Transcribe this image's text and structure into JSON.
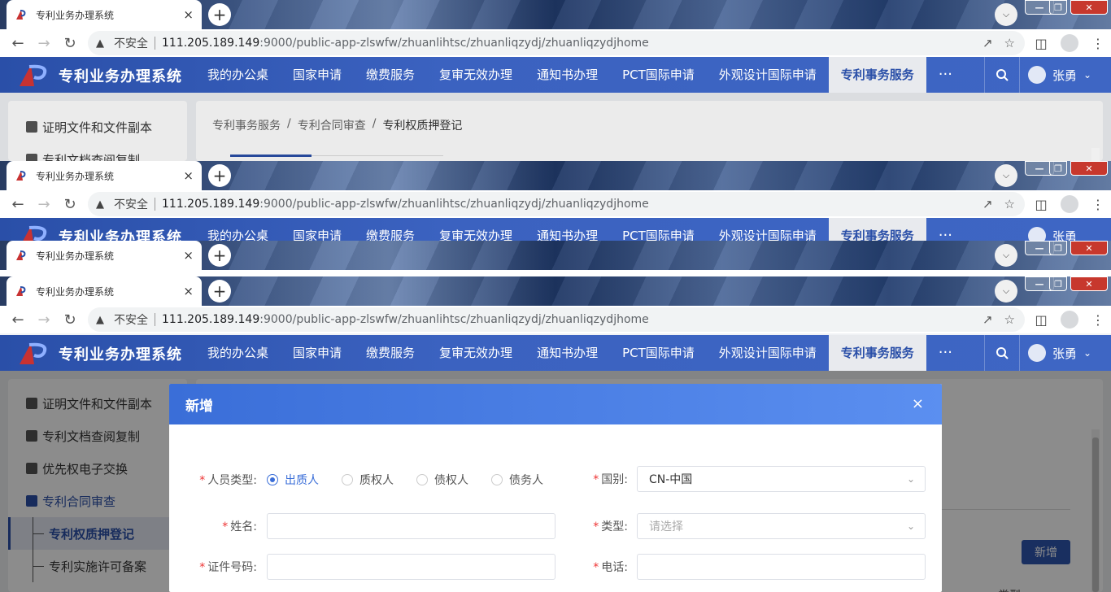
{
  "browser": {
    "tab_title": "专利业务办理系统",
    "tab_close": "×",
    "new_tab": "+",
    "insecure_label": "不安全",
    "url_host": "111.205.189.149",
    "url_rest": ":9000/public-app-zlswfw/zhuanlihtsc/zhuanliqzydj/zhuanliqzydjhome"
  },
  "app": {
    "name": "专利业务办理系统",
    "menu": [
      "我的办公桌",
      "国家申请",
      "缴费服务",
      "复审无效办理",
      "通知书办理",
      "PCT国际申请",
      "外观设计国际申请",
      "专利事务服务"
    ],
    "more": "···",
    "user": "张勇"
  },
  "breadcrumb": [
    "专利事务服务",
    "/",
    "专利合同审查",
    "/",
    "专利权质押登记"
  ],
  "sidebar": {
    "items": [
      "证明文件和文件副本",
      "专利文档查阅复制",
      "优先权电子交换",
      "专利合同审查"
    ],
    "sub_items": [
      "专利权质押登记",
      "专利实施许可备案"
    ],
    "partial_item": "专利文档查阅复制"
  },
  "main": {
    "add_button": "新增",
    "col_partial": "类型"
  },
  "modal": {
    "title": "新增",
    "close": "×",
    "person_type_label": "人员类型:",
    "person_types": [
      "出质人",
      "质权人",
      "债权人",
      "债务人"
    ],
    "selected_person_type": "出质人",
    "country_label": "国别:",
    "country_value": "CN-中国",
    "name_label": "姓名:",
    "name_value": "",
    "type_label": "类型:",
    "type_placeholder": "请选择",
    "id_label": "证件号码:",
    "id_value": "",
    "phone_label": "电话:",
    "phone_value": ""
  }
}
